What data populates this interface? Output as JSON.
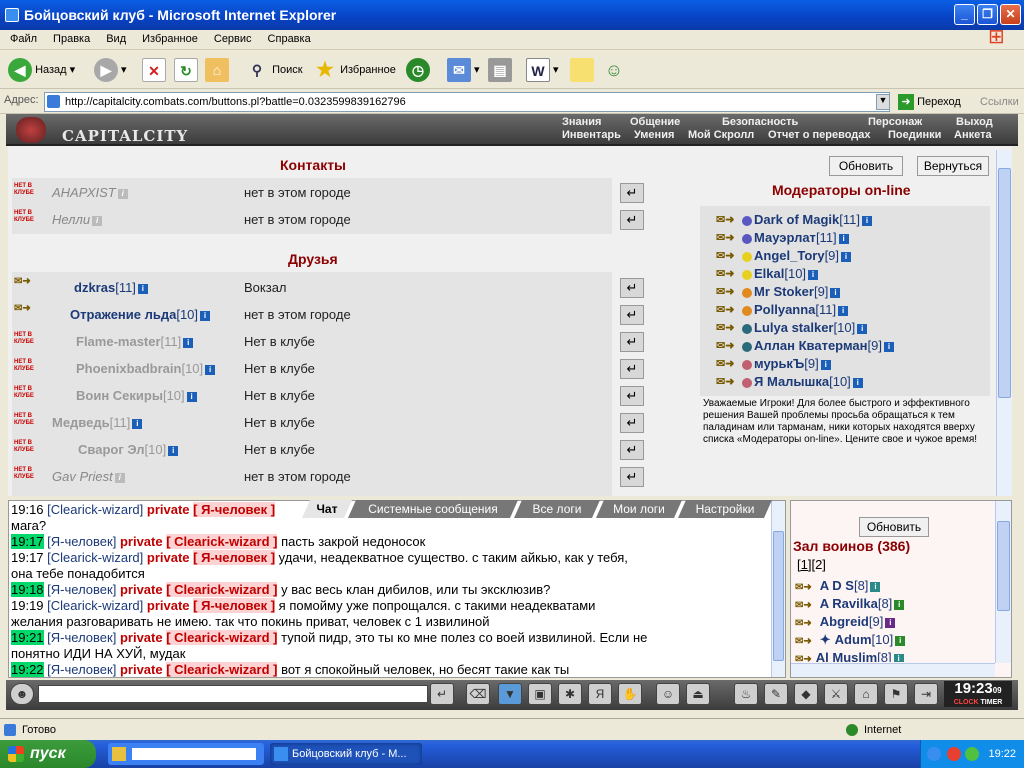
{
  "window": {
    "title": "Бойцовский клуб - Microsoft Internet Explorer",
    "minimize": "_",
    "maximize": "❐",
    "close": "✕"
  },
  "menu": [
    "Файл",
    "Правка",
    "Вид",
    "Избранное",
    "Сервис",
    "Справка"
  ],
  "toolbar": {
    "back": "Назад",
    "search": "Поиск",
    "favorites": "Избранное"
  },
  "address": {
    "label": "Адрес:",
    "url": "http://capitalcity.combats.com/buttons.pl?battle=0.0323599839162796",
    "go": "Переход",
    "links": "Ссылки"
  },
  "game": {
    "logo": "CAPITALCITY",
    "nav_top": [
      "Знания",
      "Общение",
      "Безопасность",
      "Персонаж",
      "Выход"
    ],
    "nav_bottom": [
      "Инвентарь",
      "Умения",
      "Мой Скролл",
      "Отчет о переводах",
      "Поединки",
      "Анкета"
    ]
  },
  "contacts": {
    "title": "Контакты",
    "badge": "НЕТ В КЛУБЕ",
    "rows": [
      {
        "nick": "АНАРХIST",
        "status": "нет в этом городе"
      },
      {
        "nick": "Нелли",
        "status": "нет в этом городе"
      }
    ]
  },
  "friends": {
    "title": "Друзья",
    "rows": [
      {
        "nick": "dzkras",
        "level": "[11]",
        "status": "Вокзал"
      },
      {
        "nick": "Отражение льда",
        "level": "[10]",
        "status": "нет в этом городе"
      },
      {
        "nick": "Flame-master",
        "level": "[11]",
        "status": "Нет в клубе"
      },
      {
        "nick": "Phoenixbadbrain",
        "level": "[10]",
        "status": "Нет в клубе"
      },
      {
        "nick": "Воин Секиры",
        "level": "[10]",
        "status": "Нет в клубе"
      },
      {
        "nick": "Медведь",
        "level": "[11]",
        "status": "Нет в клубе"
      },
      {
        "nick": "Сварог Эл",
        "level": "[10]",
        "status": "Нет в клубе"
      },
      {
        "nick": "Gav Priest",
        "level": "",
        "status": "нет в этом городе"
      }
    ]
  },
  "buttons": {
    "refresh": "Обновить",
    "back": "Вернуться",
    "refresh2": "Обновить"
  },
  "moderators": {
    "title": "Модераторы on-line",
    "rows": [
      {
        "nick": "Dark of Magik",
        "level": "[11]"
      },
      {
        "nick": "Мауэрлат",
        "level": "[11]"
      },
      {
        "nick": "Angel_Tory",
        "level": "[9]"
      },
      {
        "nick": "Elkal",
        "level": "[10]"
      },
      {
        "nick": "Mr Stoker",
        "level": "[9]"
      },
      {
        "nick": "Pollyanna",
        "level": "[11]"
      },
      {
        "nick": "Lulya stalker",
        "level": "[10]"
      },
      {
        "nick": "Аллан Кватерман",
        "level": "[9]"
      },
      {
        "nick": "мурькЪ",
        "level": "[9]"
      },
      {
        "nick": "Я Малышка",
        "level": "[10]"
      }
    ],
    "notice": "Уважаемые Игроки! Для более быстрого и эффективного решения Вашей проблемы просьба обращаться к тем паладинам или тарманам, ники которых находятся вверху списка «Модераторы on-line». Цените свое и чужое время!"
  },
  "chat": {
    "tabs": [
      "Чат",
      "Системные сообщения",
      "Все логи",
      "Мои логи",
      "Настройки"
    ],
    "lines": [
      {
        "time": "19:16",
        "hl": false,
        "from": "[Clearick-wizard]",
        "priv": "private",
        "to": "[ Я-человек ]",
        "text": " мага?"
      },
      {
        "time": "19:17",
        "hl": true,
        "from": "[Я-человек]",
        "priv": "private",
        "to": "[ Clearick-wizard ]",
        "text": " пасть закрой недоносок"
      },
      {
        "time": "19:17",
        "hl": false,
        "from": "[Clearick-wizard]",
        "priv": "private",
        "to": "[ Я-человек ]",
        "text": " удачи, неадекватное существо. с таким айкью, как у тебя,"
      },
      {
        "time": "",
        "hl": false,
        "from": "",
        "priv": "",
        "to": "",
        "text": "она тебе понадобится"
      },
      {
        "time": "19:18",
        "hl": true,
        "from": "[Я-человек]",
        "priv": "private",
        "to": "[ Clearick-wizard ]",
        "text": " у вас весь клан дибилов, или ты эксклюзив?"
      },
      {
        "time": "19:19",
        "hl": false,
        "from": "[Clearick-wizard]",
        "priv": "private",
        "to": "[ Я-человек ]",
        "text": " я помойму уже попрощался. с такими неадекватами"
      },
      {
        "time": "",
        "hl": false,
        "from": "",
        "priv": "",
        "to": "",
        "text": "желания разговаривать не имею. так что покинь приват, человек с 1 извилиной"
      },
      {
        "time": "19:21",
        "hl": true,
        "from": "[Я-человек]",
        "priv": "private",
        "to": "[ Clearick-wizard ]",
        "text": " тупой пидр, это ты ко мне полез со воей извилиной. Если не"
      },
      {
        "time": "",
        "hl": false,
        "from": "",
        "priv": "",
        "to": "",
        "text": "понятно ИДИ НА ХУЙ, мудак"
      },
      {
        "time": "19:22",
        "hl": true,
        "from": "[Я-человек]",
        "priv": "private",
        "to": "[ Clearick-wizard ]",
        "text": " вот я спокойный человек, но бесят такие как ты"
      }
    ]
  },
  "hall": {
    "title": "Зал воинов (386)",
    "pages": [
      "[1]",
      "[2]"
    ],
    "players": [
      {
        "nick": "A D S",
        "level": "[8]"
      },
      {
        "nick": "A Ravilka",
        "level": "[8]"
      },
      {
        "nick": "Abgreid",
        "level": "[9]"
      },
      {
        "nick": "Adum",
        "level": "[10]"
      },
      {
        "nick": "Al Muslim",
        "level": "[8]"
      }
    ]
  },
  "clock": {
    "time": "19:23",
    "sec": "09",
    "left": "CLOCK",
    "right": "TIMER"
  },
  "status": {
    "text": "Готово",
    "zone": "Internet"
  },
  "taskbar": {
    "start": "пуск",
    "task1": "Бойцовский клуб - М...",
    "time": "19:22"
  }
}
